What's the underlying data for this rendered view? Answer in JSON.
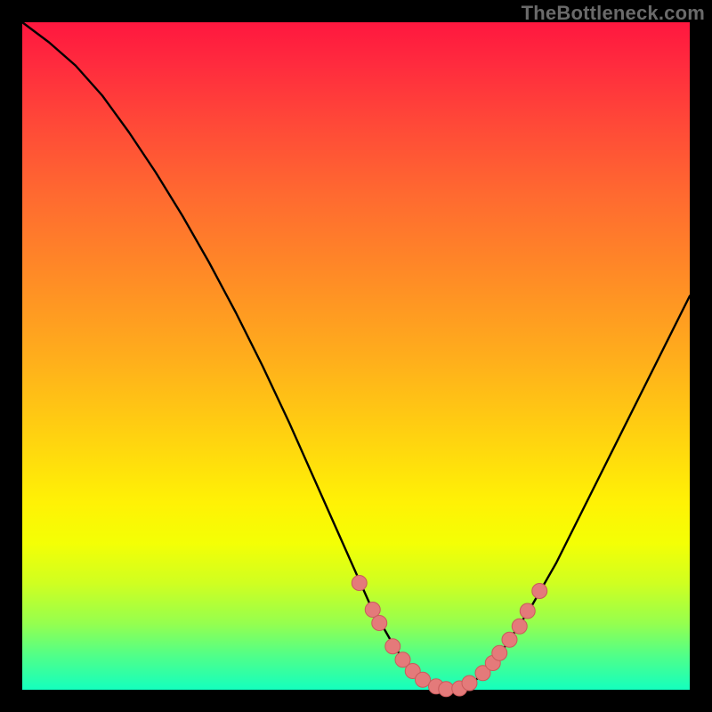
{
  "watermark": "TheBottleneck.com",
  "colors": {
    "background": "#000000",
    "curve": "#000000",
    "marker_fill": "#e47a7a",
    "marker_stroke": "#c95b5c"
  },
  "chart_data": {
    "type": "line",
    "title": "",
    "xlabel": "",
    "ylabel": "",
    "xlim": [
      0,
      100
    ],
    "ylim": [
      0,
      100
    ],
    "grid": false,
    "legend": false,
    "series": [
      {
        "name": "bottleneck-curve",
        "x": [
          0,
          4,
          8,
          12,
          16,
          20,
          24,
          28,
          32,
          36,
          40,
          44,
          48,
          52,
          56,
          60,
          64,
          68,
          72,
          76,
          80,
          84,
          88,
          92,
          96,
          100
        ],
        "y": [
          100,
          97,
          93.5,
          89,
          83.5,
          77.5,
          71,
          64,
          56.5,
          48.5,
          40,
          31,
          22,
          13,
          6,
          1.5,
          0,
          1.5,
          6,
          12,
          19,
          27,
          35,
          43,
          51,
          59
        ]
      }
    ],
    "markers": {
      "name": "highlight-dots",
      "color": "#e47a7a",
      "points": [
        {
          "x": 50.5,
          "y": 16.0
        },
        {
          "x": 52.5,
          "y": 12.0
        },
        {
          "x": 53.5,
          "y": 10.0
        },
        {
          "x": 55.5,
          "y": 6.5
        },
        {
          "x": 57.0,
          "y": 4.5
        },
        {
          "x": 58.5,
          "y": 2.8
        },
        {
          "x": 60.0,
          "y": 1.5
        },
        {
          "x": 62.0,
          "y": 0.5
        },
        {
          "x": 63.5,
          "y": 0.1
        },
        {
          "x": 65.5,
          "y": 0.2
        },
        {
          "x": 67.0,
          "y": 1.0
        },
        {
          "x": 69.0,
          "y": 2.5
        },
        {
          "x": 70.5,
          "y": 4.0
        },
        {
          "x": 71.5,
          "y": 5.5
        },
        {
          "x": 73.0,
          "y": 7.5
        },
        {
          "x": 74.5,
          "y": 9.5
        },
        {
          "x": 75.7,
          "y": 11.8
        },
        {
          "x": 77.5,
          "y": 14.8
        }
      ]
    }
  }
}
